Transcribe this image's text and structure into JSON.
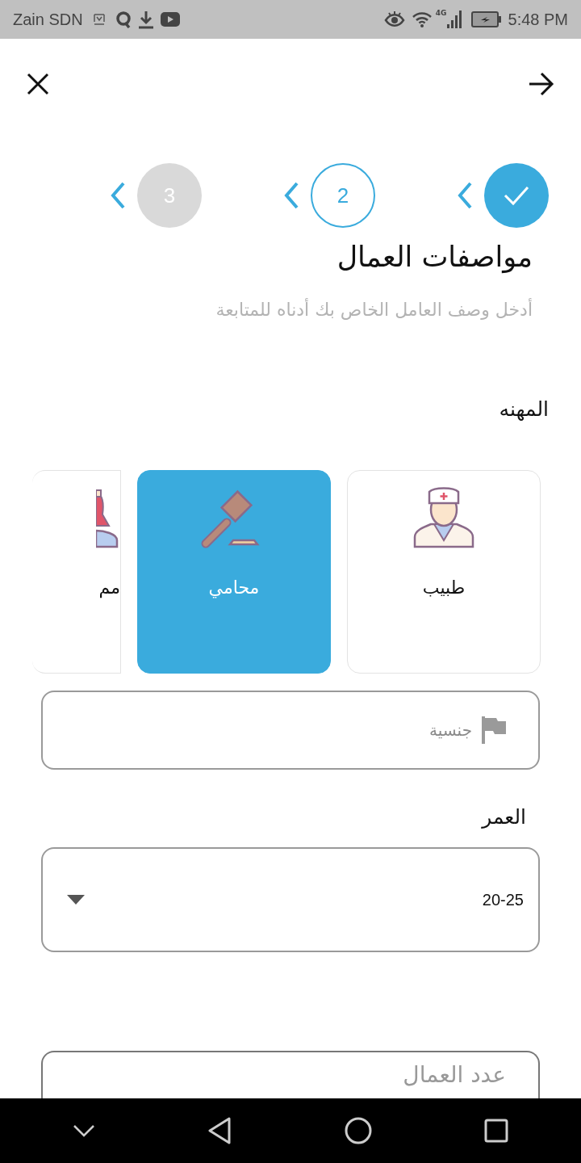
{
  "status_bar": {
    "carrier": "Zain SDN",
    "network": "4G",
    "time": "5:48 PM"
  },
  "steps": [
    {
      "done": true,
      "selected": false
    },
    {
      "label": "2",
      "done": false,
      "selected": true
    },
    {
      "label": "3",
      "done": false,
      "selected": false
    }
  ],
  "title": "مواصفات العمال",
  "subtitle": "أدخل وصف العامل الخاص بك أدناه للمتابعة",
  "profession": {
    "label": "المهنه",
    "options": [
      {
        "label": "طبيب",
        "selected": false
      },
      {
        "label": "محامي",
        "selected": true
      },
      {
        "label": "مم",
        "selected": false
      }
    ]
  },
  "nationality": {
    "placeholder": "جنسية"
  },
  "age": {
    "label": "العمر",
    "value": "20-25"
  },
  "workers": {
    "placeholder": "عدد العمال"
  }
}
